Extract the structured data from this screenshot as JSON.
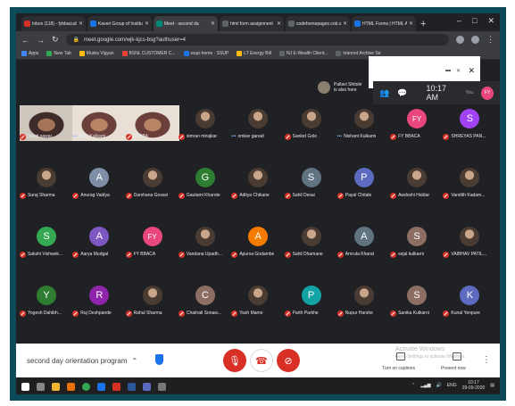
{
  "browser": {
    "tabs": [
      {
        "label": "Inbox (118) - fybbacud",
        "color": "#d93025"
      },
      {
        "label": "Kaveri Group of Institu",
        "color": "#1a73e8"
      },
      {
        "label": "Meet - second da",
        "color": "#00897b"
      },
      {
        "label": "html form assignment",
        "color": "#5f6368"
      },
      {
        "label": "codehomepages.cob.sc",
        "color": "#5f6368"
      },
      {
        "label": "HTML Forms | HTML A",
        "color": "#1a73e8"
      }
    ],
    "url": "meet.google.com/wjk-kjcs-bsg?authuser=4",
    "bookmarks": [
      "Apps",
      "New Tab",
      "Mudra Vigyan",
      "BSNL CUSTOMER C...",
      "ssup-home · SSUP",
      "LT Energy Bill",
      "NJ E-Wealth Client...",
      "Internet Archive Se"
    ]
  },
  "header": {
    "presenter_name": "Pallavi Shitole",
    "presenter_status": "is also here",
    "time": "10:17 AM",
    "you_label": "You",
    "you_initials": "FY"
  },
  "participants": [
    {
      "name": "Swati pawar",
      "kind": "video"
    },
    {
      "name": "Aarti Kulkarni",
      "kind": "video"
    },
    {
      "name": "FYBBA",
      "kind": "video"
    },
    {
      "name": "simran mirajkar",
      "kind": "photo"
    },
    {
      "name": "omkar ganad",
      "kind": "photo"
    },
    {
      "name": "Sanket Gole",
      "kind": "photo"
    },
    {
      "name": "Nishant Kulkarni",
      "kind": "photo"
    },
    {
      "name": "FY BBACA",
      "kind": "letter",
      "letter": "FY",
      "color": "#e8467c"
    },
    {
      "name": "SHREYAS PAN...",
      "kind": "letter",
      "letter": "S",
      "color": "#a142f4"
    },
    {
      "name": "Suraj Sharma",
      "kind": "photo"
    },
    {
      "name": "Anurag Vaidya",
      "kind": "letter",
      "letter": "A",
      "color": "#7d8ea6"
    },
    {
      "name": "Darshana Gosavi",
      "kind": "photo"
    },
    {
      "name": "Gautami Kharote",
      "kind": "letter",
      "letter": "G",
      "color": "#2e7d32"
    },
    {
      "name": "Aditya Chikane",
      "kind": "photo"
    },
    {
      "name": "Sahil Desai",
      "kind": "letter",
      "letter": "S",
      "color": "#5f7381"
    },
    {
      "name": "Payal Chitale",
      "kind": "letter",
      "letter": "P",
      "color": "#5c6bc0"
    },
    {
      "name": "Awdoshi Haldar",
      "kind": "photo"
    },
    {
      "name": "Vandith Kadam...",
      "kind": "photo"
    },
    {
      "name": "Sakshi Vishwek...",
      "kind": "letter",
      "letter": "S",
      "color": "#34a853"
    },
    {
      "name": "Aarya Mudgal",
      "kind": "letter",
      "letter": "A",
      "color": "#7e57c2"
    },
    {
      "name": "FY BBACA",
      "kind": "letter",
      "letter": "FY",
      "color": "#e8467c"
    },
    {
      "name": "Vandana Upadh...",
      "kind": "photo"
    },
    {
      "name": "Apurva Godambe",
      "kind": "letter",
      "letter": "A",
      "color": "#f57c00"
    },
    {
      "name": "Sahil Dhamane",
      "kind": "photo"
    },
    {
      "name": "Amruta Kharat",
      "kind": "letter",
      "letter": "A",
      "color": "#5f7381"
    },
    {
      "name": "sejal kulkarni",
      "kind": "letter",
      "letter": "S",
      "color": "#8d6e63"
    },
    {
      "name": "VAIBHAV PATIL...",
      "kind": "photo"
    },
    {
      "name": "Yogesh Dahibh...",
      "kind": "letter",
      "letter": "Y",
      "color": "#2e7d32"
    },
    {
      "name": "Raj Deshpande",
      "kind": "letter",
      "letter": "R",
      "color": "#8e24aa"
    },
    {
      "name": "Rahul Sharma",
      "kind": "photo"
    },
    {
      "name": "Chaitrali Sonaw...",
      "kind": "letter",
      "letter": "C",
      "color": "#8d6e63"
    },
    {
      "name": "Yash Mame",
      "kind": "photo"
    },
    {
      "name": "Parth Parkhe",
      "kind": "letter",
      "letter": "P",
      "color": "#12a4a4"
    },
    {
      "name": "Nupur Harshe",
      "kind": "photo"
    },
    {
      "name": "Sanika Kulkarni",
      "kind": "letter",
      "letter": "S",
      "color": "#8d6e63"
    },
    {
      "name": "Kunal Yenpure",
      "kind": "letter",
      "letter": "K",
      "color": "#5c6bc0"
    }
  ],
  "bottom": {
    "meeting_title": "second day orientation program",
    "captions_label": "Turn on captions",
    "present_label": "Present now",
    "activate_title": "Activate Windows",
    "activate_sub": "Go to Settings to activate Windows."
  },
  "taskbar": {
    "lang": "ENG",
    "time": "10:17",
    "date": "29-09-2020"
  }
}
